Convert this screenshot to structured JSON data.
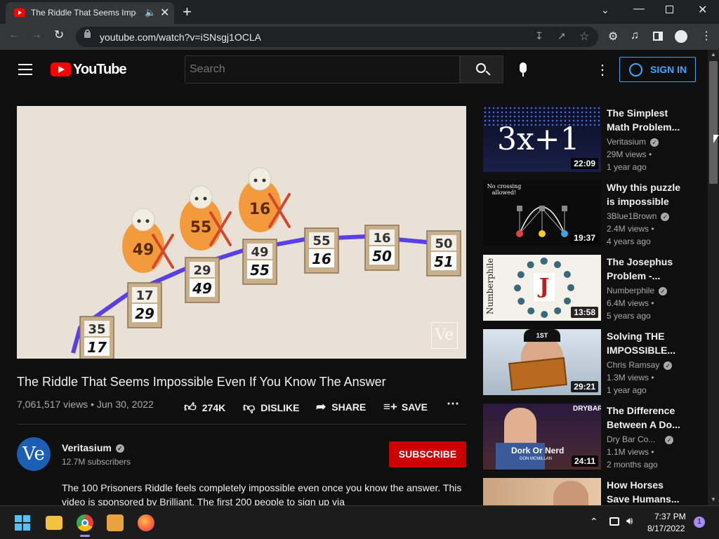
{
  "browser": {
    "tab_title": "The Riddle That Seems Impo",
    "url": "youtube.com/watch?v=iSNsgj1OCLA"
  },
  "masthead": {
    "logo_text": "YouTube",
    "search_placeholder": "Search",
    "signin_label": "SIGN IN"
  },
  "video": {
    "title": "The Riddle That Seems Impossible Even If You Know The Answer",
    "views_date": "7,061,517 views • Jun 30, 2022",
    "likes": "274K",
    "dislike_label": "DISLIKE",
    "share_label": "SHARE",
    "save_label": "SAVE",
    "watermark": "Ve",
    "frame": {
      "stack": [
        {
          "top": "",
          "bottom": ""
        },
        {
          "top": "35",
          "bottom": "17"
        },
        {
          "top": "17",
          "bottom": "29"
        },
        {
          "top": "29",
          "bottom": "49"
        },
        {
          "top": "49",
          "bottom": "55"
        },
        {
          "top": "55",
          "bottom": "16"
        },
        {
          "top": "16",
          "bottom": "50"
        },
        {
          "top": "50",
          "bottom": "51"
        }
      ],
      "prisoners": [
        "49",
        "55",
        "16"
      ]
    }
  },
  "channel": {
    "name": "Veritasium",
    "subscribers": "12.7M subscribers",
    "avatar_text": "Ve",
    "subscribe_label": "SUBSCRIBE"
  },
  "description": "The 100 Prisoners Riddle feels completely impossible even once you know the answer. This video is sponsored by Brilliant. The first 200 people to sign up via",
  "recommendations": [
    {
      "title_line1": "The Simplest",
      "title_line2": "Math Problem...",
      "channel": "Veritasium",
      "views": "29M views •",
      "age": "1 year ago",
      "duration": "22:09",
      "thumb_text": "3x+1"
    },
    {
      "title_line1": "Why this puzzle",
      "title_line2": "is impossible",
      "channel": "3Blue1Brown",
      "views": "2.4M views •",
      "age": "4 years ago",
      "duration": "19:37",
      "thumb_text": "No crossing allowed!"
    },
    {
      "title_line1": "The Josephus",
      "title_line2": "Problem -...",
      "channel": "Numberphile",
      "views": "6.4M views •",
      "age": "5 years ago",
      "duration": "13:58",
      "thumb_text": "Numberphile",
      "thumb_letter": "J"
    },
    {
      "title_line1": "Solving THE",
      "title_line2": "IMPOSSIBLE...",
      "channel": "Chris Ramsay",
      "views": "1.3M views •",
      "age": "1 year ago",
      "duration": "29:21",
      "thumb_text": "1ST"
    },
    {
      "title_line1": "The Difference",
      "title_line2": "Between A Do...",
      "channel": "Dry Bar Co...",
      "views": "1.1M views •",
      "age": "2 months ago",
      "duration": "24:11",
      "thumb_text": "Dork Or Nerd",
      "thumb_sub": "DON MCMILLAN",
      "thumb_brand": "DRYBAR"
    },
    {
      "title_line1": "How Horses",
      "title_line2": "Save Humans...",
      "channel": "",
      "views": "",
      "age": "",
      "duration": ""
    }
  ],
  "taskbar": {
    "time": "7:37 PM",
    "date": "8/17/2022",
    "notification_count": "1"
  },
  "colors": {
    "youtube_red": "#ff0000",
    "subscribe_red": "#cc0000",
    "link_blue": "#3ea6ff",
    "background": "#0f0f0f"
  }
}
